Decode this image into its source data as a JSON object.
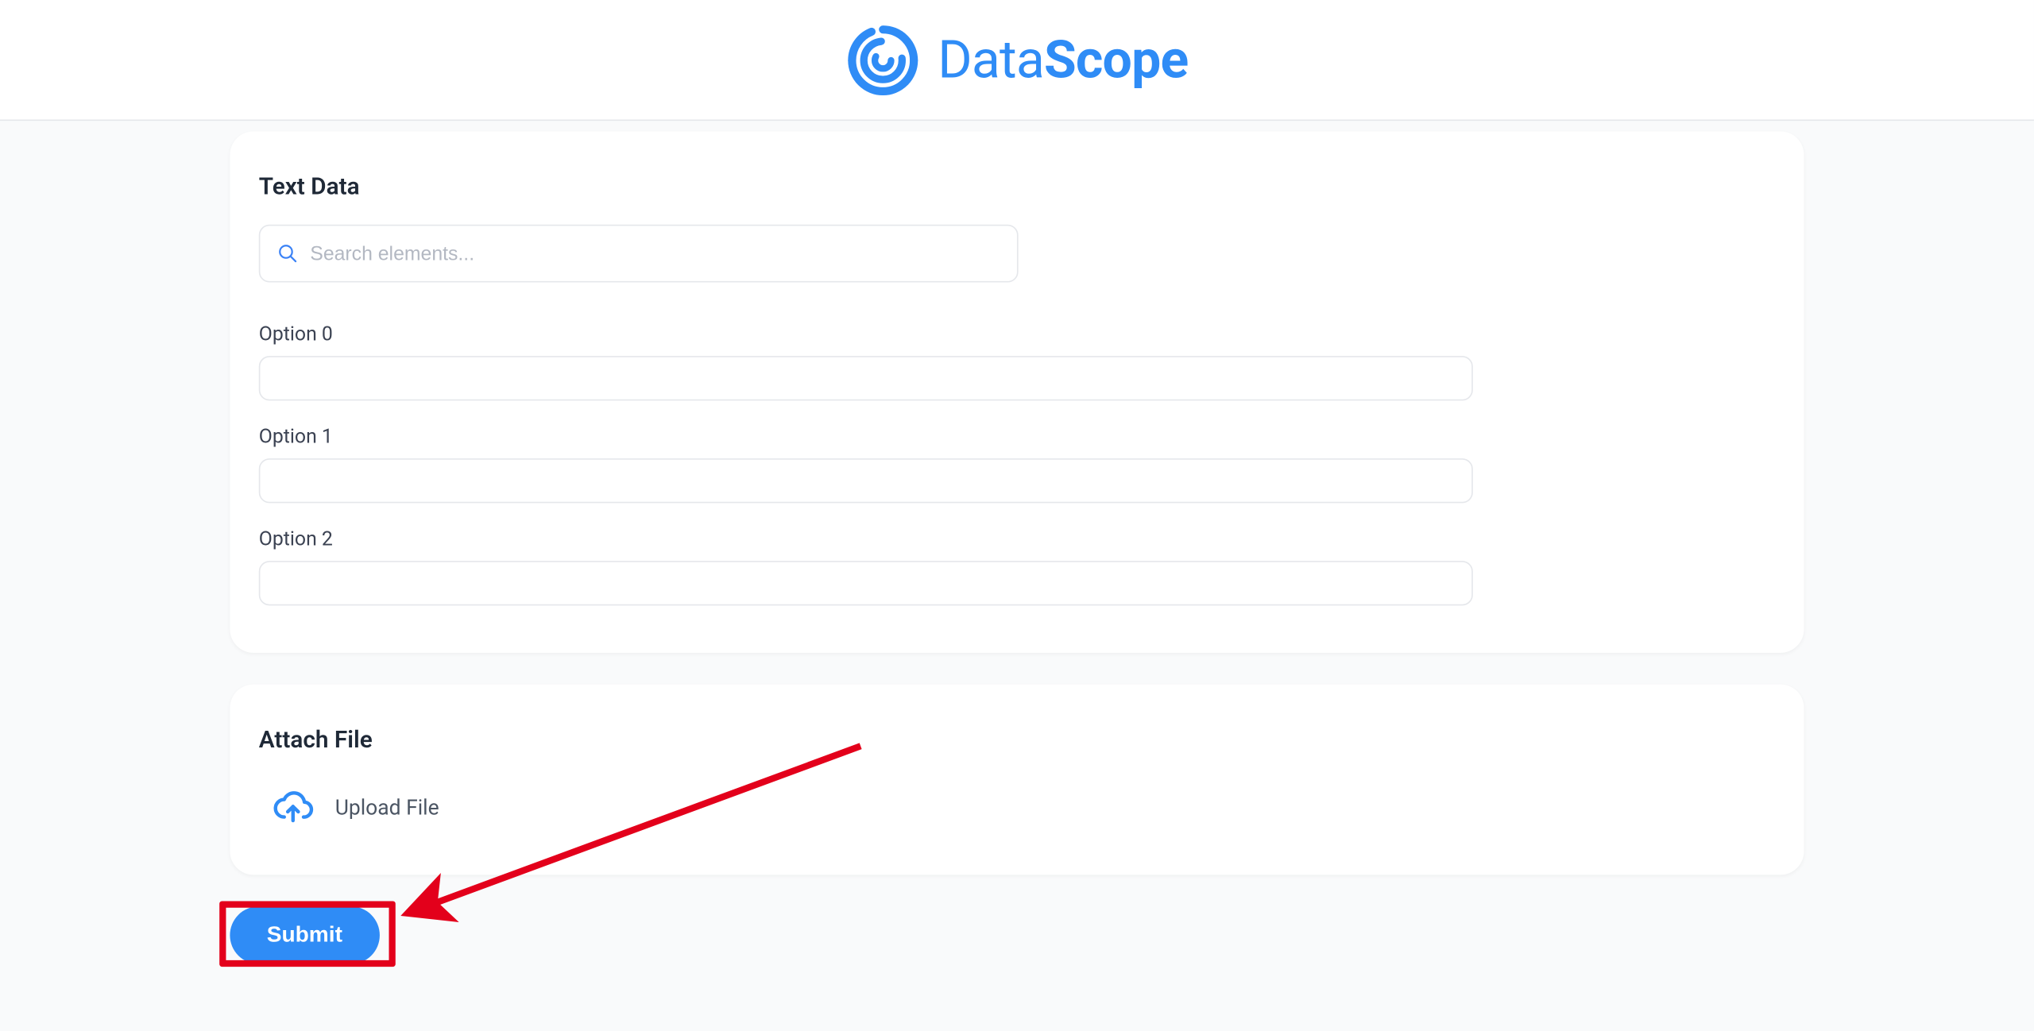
{
  "brand": {
    "name_light": "Data",
    "name_bold": "Scope"
  },
  "text_data_card": {
    "title": "Text Data",
    "search_placeholder": "Search elements..."
  },
  "options": [
    {
      "label": "Option 0",
      "value": ""
    },
    {
      "label": "Option 1",
      "value": ""
    },
    {
      "label": "Option 2",
      "value": ""
    }
  ],
  "attach_card": {
    "title": "Attach File",
    "upload_label": "Upload File"
  },
  "submit_label": "Submit",
  "colors": {
    "accent": "#2f8cf6",
    "highlight": "#e3001b"
  }
}
